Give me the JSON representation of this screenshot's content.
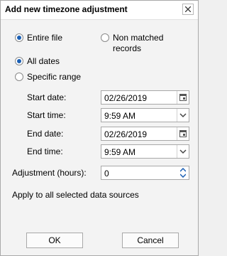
{
  "dialog": {
    "title": "Add new timezone adjustment",
    "close_icon": "close-icon"
  },
  "scope": {
    "entire_file": "Entire file",
    "non_matched": "Non matched records",
    "selected": "entire_file"
  },
  "dates": {
    "all_dates": "All dates",
    "specific_range": "Specific range",
    "selected": "all_dates"
  },
  "range": {
    "start_date_label": "Start date:",
    "start_date_value": "02/26/2019",
    "start_time_label": "Start time:",
    "start_time_value": "9:59 AM",
    "end_date_label": "End date:",
    "end_date_value": "02/26/2019",
    "end_time_label": "End time:",
    "end_time_value": "9:59 AM"
  },
  "adjustment": {
    "label": "Adjustment (hours):",
    "value": "0"
  },
  "info_text": "Apply to all selected data sources",
  "buttons": {
    "ok": "OK",
    "cancel": "Cancel"
  }
}
